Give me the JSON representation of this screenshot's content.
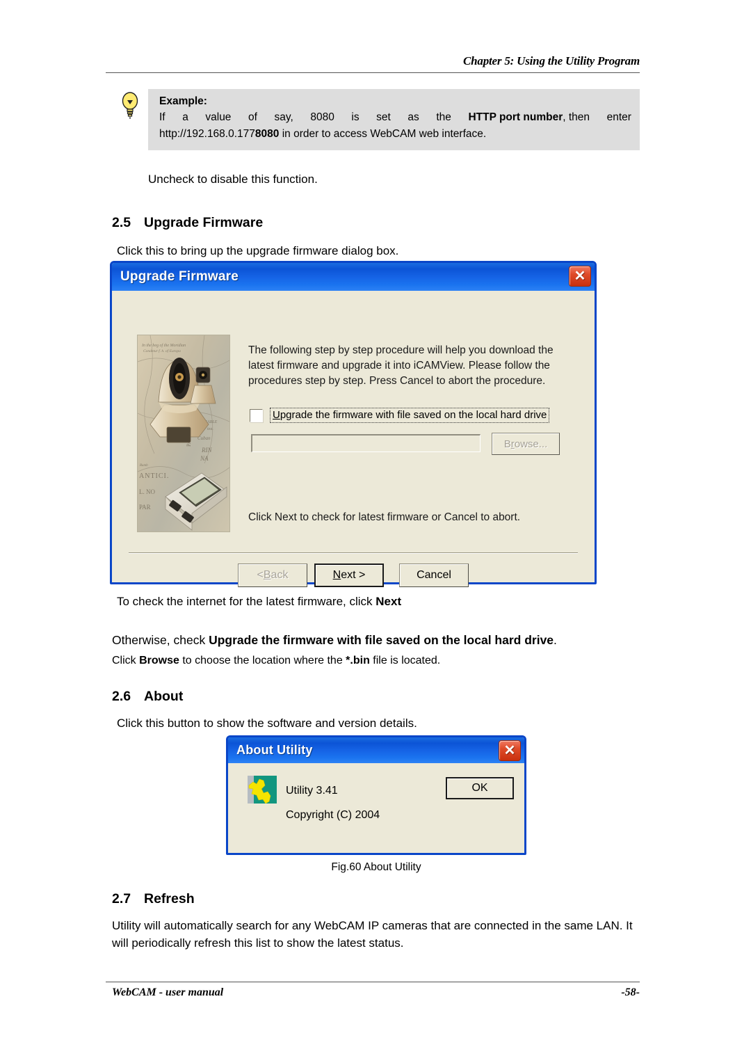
{
  "header": {
    "chapter": "Chapter 5: Using the Utility Program"
  },
  "example": {
    "icon": "lightbulb-icon",
    "title": "Example:",
    "line1_a": "If",
    "line1_b": "a",
    "line1_c": "value",
    "line1_d": "of",
    "line1_e": "say,",
    "line1_f": "8080",
    "line1_g": "is",
    "line1_h": "set",
    "line1_i": "as",
    "line1_j": "the",
    "line1_bold": "HTTP port number",
    "line1_k": ", then",
    "line1_l": "enter",
    "line2_a": "http://192.168.0.177",
    "line2_bold": "8080",
    "line2_b": " in order to access WebCAM web interface."
  },
  "body": {
    "uncheck_line": "Uncheck to disable this function.",
    "sec25_num": "2.5",
    "sec25_title": "Upgrade Firmware",
    "p_click_upgrade": "Click this to bring up the upgrade firmware dialog box.",
    "p_tocheck_a": "To check the internet for the latest firmware, click ",
    "p_tocheck_b": "Next",
    "p_otherwise_a": "Otherwise, check ",
    "p_otherwise_b": "Upgrade the firmware with file saved on the local hard drive",
    "p_otherwise_c": ".",
    "p_clickbrowse_a": "Click ",
    "p_clickbrowse_b": "Browse",
    "p_clickbrowse_c": " to choose the location where the ",
    "p_clickbrowse_d": "*.bin",
    "p_clickbrowse_e": " file is located.",
    "sec26_num": "2.6",
    "sec26_title": "About",
    "p_clickthis": "Click this button to show the software and version details.",
    "fig_caption": "Fig.60  About Utility",
    "sec27_num": "2.7",
    "sec27_title": "Refresh",
    "p_refresh": "Utility will automatically search for any WebCAM IP cameras that are connected in the same LAN.   It will periodically refresh this list to show the latest status."
  },
  "upgrade_dialog": {
    "title": "Upgrade Firmware",
    "close_icon": "close-icon",
    "thumbnail_alt": "webcam-product-photo",
    "description": "The following step by step procedure will help you download the latest firmware and upgrade it into iCAMView. Please follow the procedures step by step. Press Cancel to abort the procedure.",
    "checkbox_label_u": "U",
    "checkbox_label_rest": "pgrade the firmware with file saved on the local hard drive",
    "checkbox_checked": "false",
    "path_value": "",
    "browse_label_b": "B",
    "browse_label_r": "r",
    "browse_label_rest": "owse...",
    "browse_disabled": "true",
    "note": "Click Next to check for latest firmware or Cancel to abort.",
    "back_label_a": "< ",
    "back_label_u": "B",
    "back_label_rest": "ack",
    "back_disabled": "true",
    "next_label_u": "N",
    "next_label_rest": "ext >",
    "cancel_label": "Cancel"
  },
  "about_dialog": {
    "title": "About Utility",
    "close_icon": "close-icon",
    "app_icon": "utility-app-icon",
    "version_line": "Utility 3.41",
    "copyright_line": "Copyright (C) 2004",
    "ok_label": "OK"
  },
  "footer": {
    "left": "WebCAM - user manual",
    "right": "-58-"
  },
  "colors": {
    "titlebar_blue": "#0c54d6",
    "dialog_face": "#ece9d8",
    "dialog_border": "#0a46c8",
    "close_red": "#c9300f",
    "example_bg": "#dddddd",
    "icon_teal": "#12967f",
    "icon_yellow": "#f5e400"
  }
}
